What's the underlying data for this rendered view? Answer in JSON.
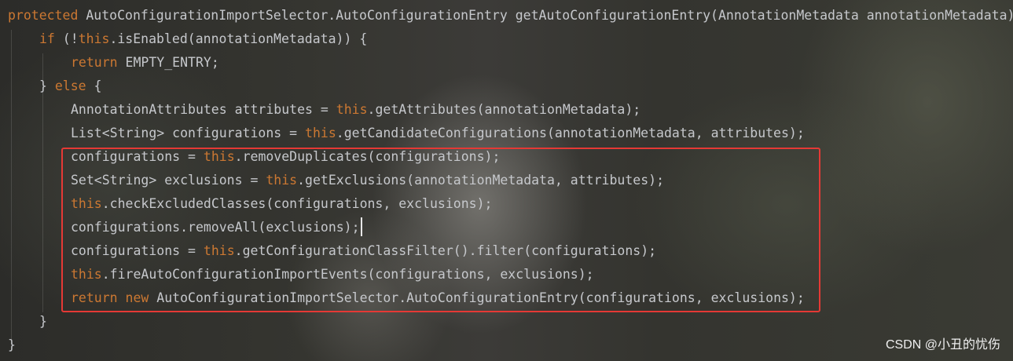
{
  "code_lines": [
    [
      "protected",
      "AutoConfigurationImportSelector.AutoConfigurationEntry getAutoConfigurationEntry(AnnotationMetadata annotationMetadata) {"
    ],
    [
      "if",
      " (!",
      "this",
      ".isEnabled(annotationMetadata)) {"
    ],
    [
      "return",
      " EMPTY_ENTRY;"
    ],
    [
      "} ",
      "else",
      " {"
    ],
    [
      "AnnotationAttributes attributes = ",
      "this",
      ".getAttributes(annotationMetadata);"
    ],
    [
      "List<String> configurations = ",
      "this",
      ".getCandidateConfigurations(annotationMetadata, attributes);"
    ],
    [
      "configurations = ",
      "this",
      ".removeDuplicates(configurations);"
    ],
    [
      "Set<String> exclusions = ",
      "this",
      ".getExclusions(annotationMetadata, attributes);"
    ],
    [
      "this",
      ".checkExcludedClasses(configurations, exclusions);"
    ],
    [
      "configurations.removeAll(exclusions);"
    ],
    [
      "configurations = ",
      "this",
      ".getConfigurationClassFilter().filter(configurations);"
    ],
    [
      "this",
      ".fireAutoConfigurationImportEvents(configurations, exclusions);"
    ],
    [
      "return",
      " ",
      "new",
      " AutoConfigurationImportSelector.AutoConfigurationEntry(configurations, exclusions);"
    ],
    [
      "}"
    ],
    [
      "}"
    ]
  ],
  "watermark": "CSDN @小丑的忧伤",
  "colors": {
    "keyword": "#cc7832",
    "code_text": "#c6c8cc",
    "highlight_border": "#e53935",
    "watermark": "#f0f0f0"
  }
}
